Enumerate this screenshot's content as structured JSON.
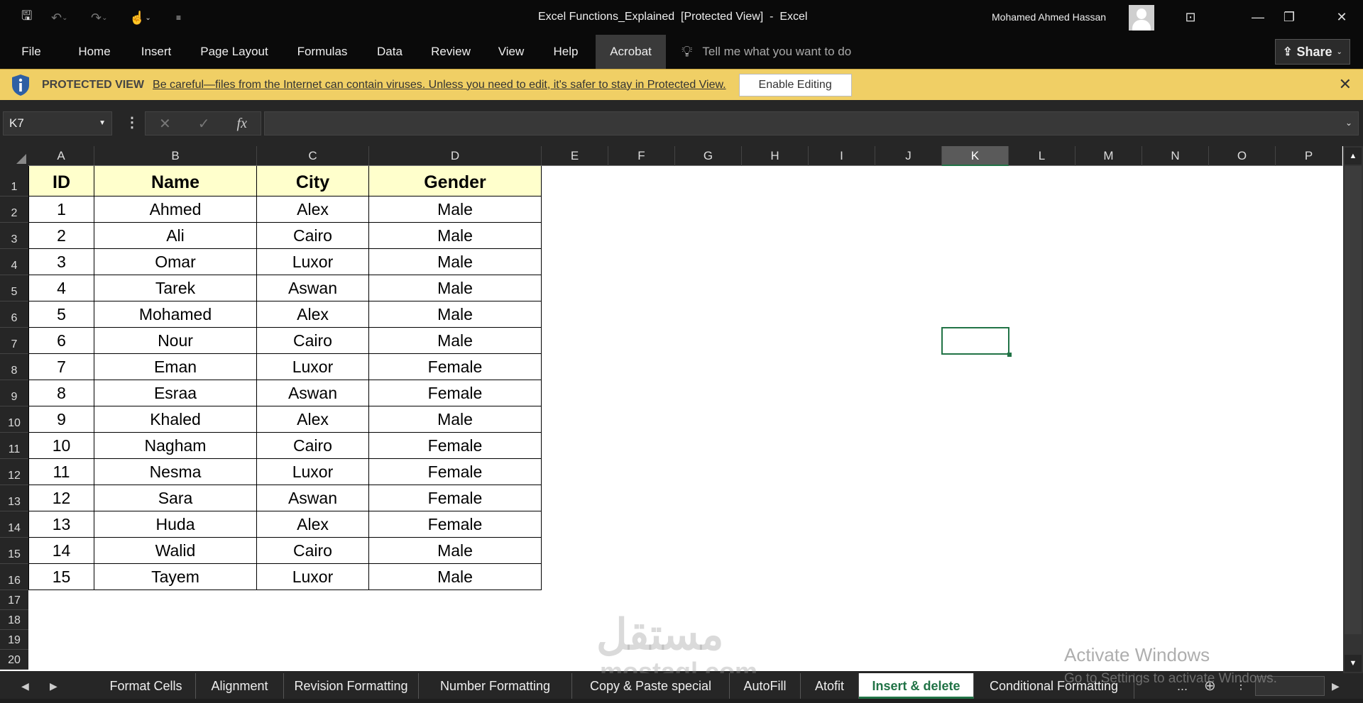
{
  "titlebar": {
    "doc_title": "Excel Functions_Explained  [Protected View]  -  Excel",
    "user_name": "Mohamed Ahmed Hassan"
  },
  "ribbon": {
    "tabs": [
      "File",
      "Home",
      "Insert",
      "Page Layout",
      "Formulas",
      "Data",
      "Review",
      "View",
      "Help",
      "Acrobat"
    ],
    "active_tab": "Acrobat",
    "tell_me": "Tell me what you want to do",
    "share": "Share"
  },
  "protected_view": {
    "label": "PROTECTED VIEW",
    "message": "Be careful—files from the Internet can contain viruses. Unless you need to edit, it's safer to stay in Protected View.",
    "enable_button": "Enable Editing"
  },
  "formula_bar": {
    "name_box": "K7",
    "fx": "fx",
    "formula": ""
  },
  "sheet": {
    "columns": [
      "A",
      "B",
      "C",
      "D",
      "E",
      "F",
      "G",
      "H",
      "I",
      "J",
      "K",
      "L",
      "M",
      "N",
      "O",
      "P"
    ],
    "rows": [
      "1",
      "2",
      "3",
      "4",
      "5",
      "6",
      "7",
      "8",
      "9",
      "10",
      "11",
      "12",
      "13",
      "14",
      "15",
      "16",
      "17",
      "18",
      "19",
      "20"
    ],
    "selected_cell": "K7",
    "header": [
      "ID",
      "Name",
      "City",
      "Gender"
    ],
    "data": [
      [
        "1",
        "Ahmed",
        "Alex",
        "Male"
      ],
      [
        "2",
        "Ali",
        "Cairo",
        "Male"
      ],
      [
        "3",
        "Omar",
        "Luxor",
        "Male"
      ],
      [
        "4",
        "Tarek",
        "Aswan",
        "Male"
      ],
      [
        "5",
        "Mohamed",
        "Alex",
        "Male"
      ],
      [
        "6",
        "Nour",
        "Cairo",
        "Male"
      ],
      [
        "7",
        "Eman",
        "Luxor",
        "Female"
      ],
      [
        "8",
        "Esraa",
        "Aswan",
        "Female"
      ],
      [
        "9",
        "Khaled",
        "Alex",
        "Male"
      ],
      [
        "10",
        "Nagham",
        "Cairo",
        "Female"
      ],
      [
        "11",
        "Nesma",
        "Luxor",
        "Female"
      ],
      [
        "12",
        "Sara",
        "Aswan",
        "Female"
      ],
      [
        "13",
        "Huda",
        "Alex",
        "Female"
      ],
      [
        "14",
        "Walid",
        "Cairo",
        "Male"
      ],
      [
        "15",
        "Tayem",
        "Luxor",
        "Male"
      ]
    ]
  },
  "sheet_tabs": [
    "Format Cells",
    "Alignment",
    "Revision Formatting",
    "Number Formatting",
    "Copy & Paste special",
    "AutoFill",
    "Atofit",
    "Insert & delete",
    "Conditional Formatting"
  ],
  "active_sheet": "Insert & delete",
  "more_sheets": "...",
  "watermark": {
    "arabic": "مستقل",
    "latin": "mostaql.com"
  },
  "activation": {
    "title": "Activate Windows",
    "subtitle": "Go to Settings to activate Windows."
  },
  "colors": {
    "accent": "#217346",
    "protected_bar": "#f0cf65",
    "header_fill": "#ffffcc"
  }
}
